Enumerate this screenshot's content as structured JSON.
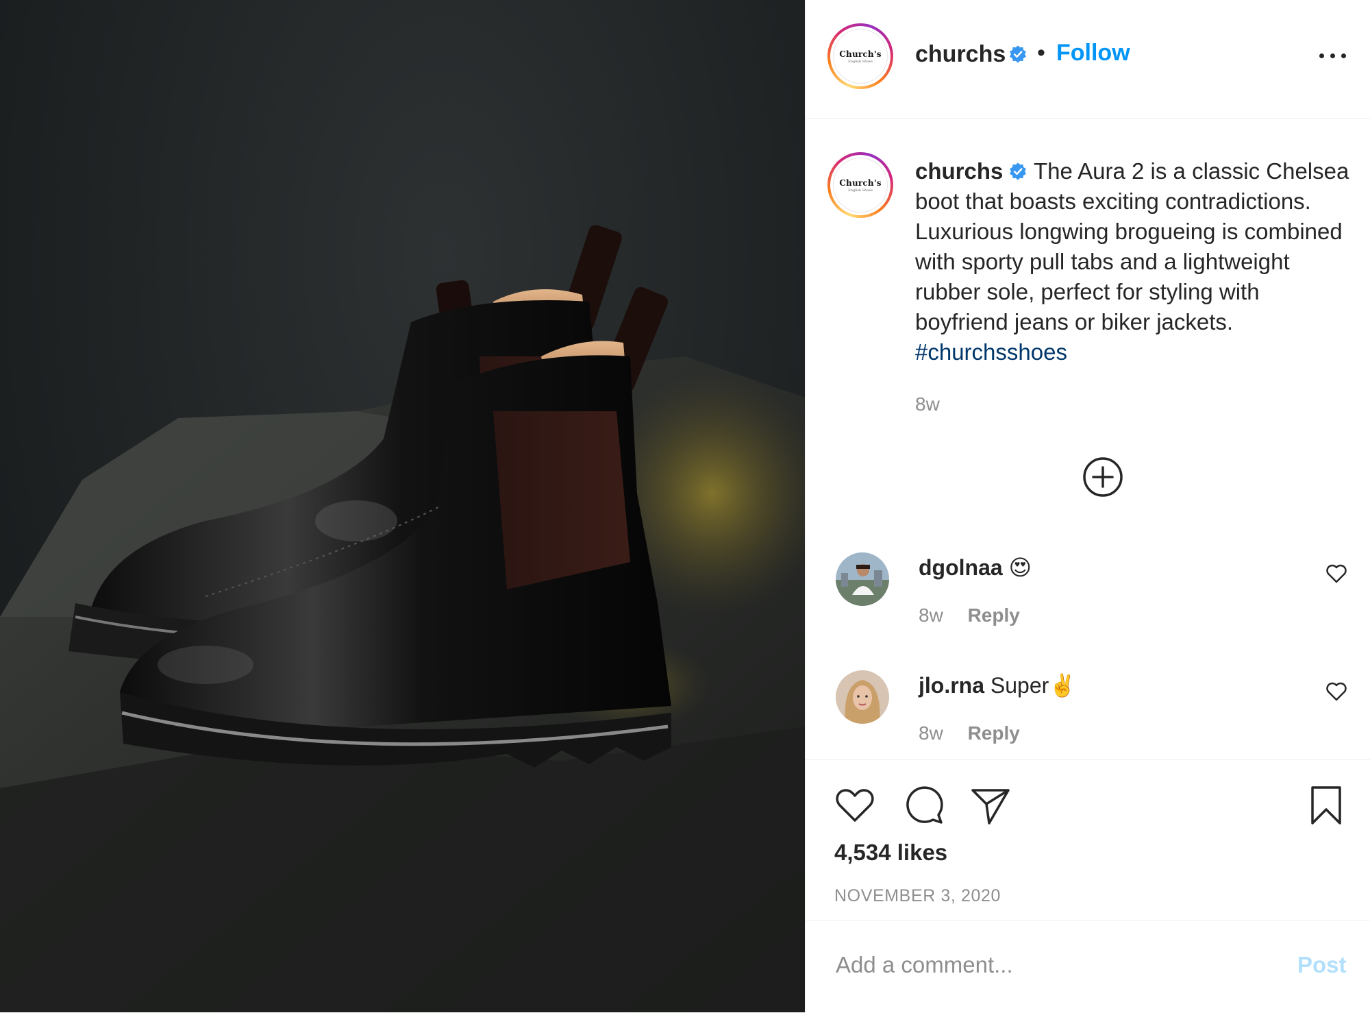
{
  "post": {
    "username": "churchs",
    "follow_label": "Follow",
    "separator": "•",
    "avatar_brand": "Church's",
    "avatar_sub": "English Shoes"
  },
  "caption": {
    "username": "churchs",
    "text": "The Aura 2 is a classic Chelsea boot that boasts exciting contradictions. Luxurious longwing brogueing is combined with sporty pull tabs and a lightweight rubber sole, perfect for styling with boyfriend jeans or biker jackets.",
    "hashtag": "#churchsshoes",
    "time": "8w"
  },
  "comments": [
    {
      "username": "dgolnaa",
      "text": "😍",
      "time": "8w",
      "reply_label": "Reply"
    },
    {
      "username": "jlo.rna",
      "text": "Super✌️",
      "time": "8w",
      "reply_label": "Reply"
    }
  ],
  "actions": {
    "likes": "4,534 likes",
    "date": "NOVEMBER 3, 2020"
  },
  "add_comment": {
    "placeholder": "Add a comment...",
    "post_label": "Post"
  },
  "icons": {
    "verified": "verified-badge-icon",
    "more": "more-options-icon",
    "plus": "load-more-comments-icon",
    "like": "heart-icon",
    "comment": "comment-bubble-icon",
    "share": "paper-plane-icon",
    "save": "bookmark-icon"
  },
  "colors": {
    "link_blue": "#0095f6",
    "hashtag": "#00376b",
    "muted": "#8e8e8e",
    "post_disabled": "#b2dffc",
    "verified": "#3897f0"
  }
}
